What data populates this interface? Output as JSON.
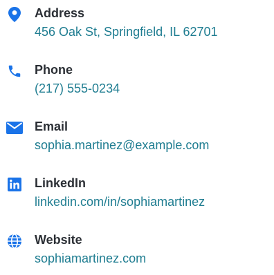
{
  "accent_color": "#1a73e8",
  "value_color": "#1f7d91",
  "contacts": [
    {
      "icon": "map-pin-icon",
      "label": "Address",
      "value": "456 Oak St, Springfield, IL 62701"
    },
    {
      "icon": "phone-icon",
      "label": "Phone",
      "value": "(217) 555-0234"
    },
    {
      "icon": "envelope-icon",
      "label": "Email",
      "value": "sophia.martinez@example.com"
    },
    {
      "icon": "linkedin-icon",
      "label": "LinkedIn",
      "value": "linkedin.com/in/sophiamartinez"
    },
    {
      "icon": "globe-icon",
      "label": "Website",
      "value": "sophiamartinez.com"
    }
  ]
}
